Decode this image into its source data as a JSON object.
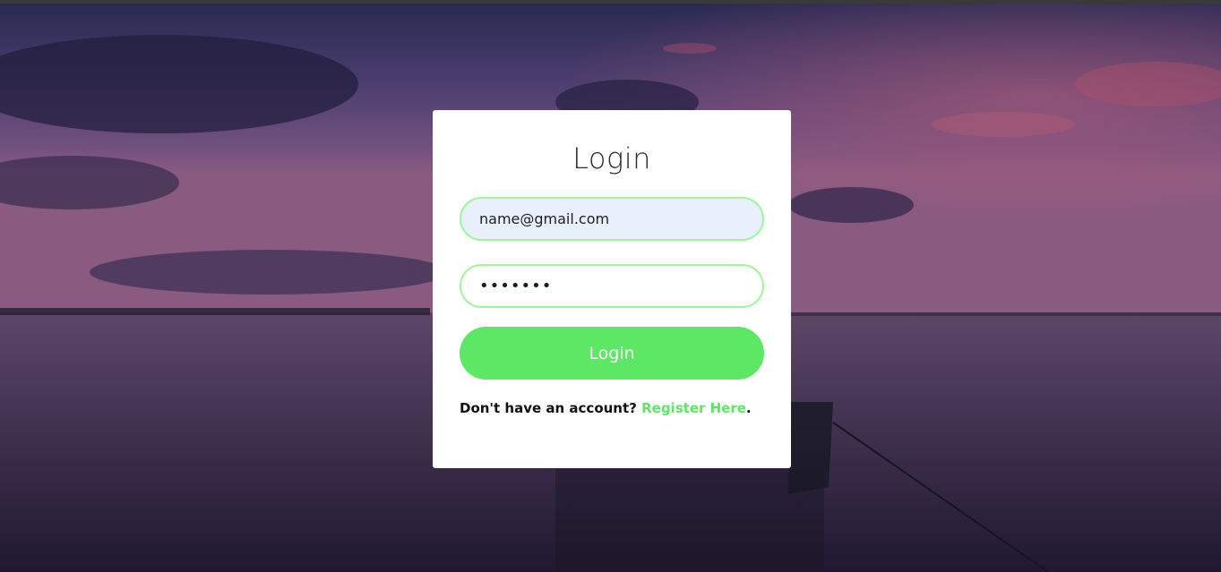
{
  "login_form": {
    "title": "Login",
    "email_value": "name@gmail.com",
    "password_value": "•••••••",
    "submit_label": "Login",
    "footer_prompt": "Don't have an account?",
    "register_link_label": "Register Here",
    "footer_suffix": "."
  },
  "colors": {
    "accent": "#5ce864",
    "field_border": "#9df79a",
    "email_bg": "#e8f0fe",
    "card_bg": "#ffffff"
  }
}
